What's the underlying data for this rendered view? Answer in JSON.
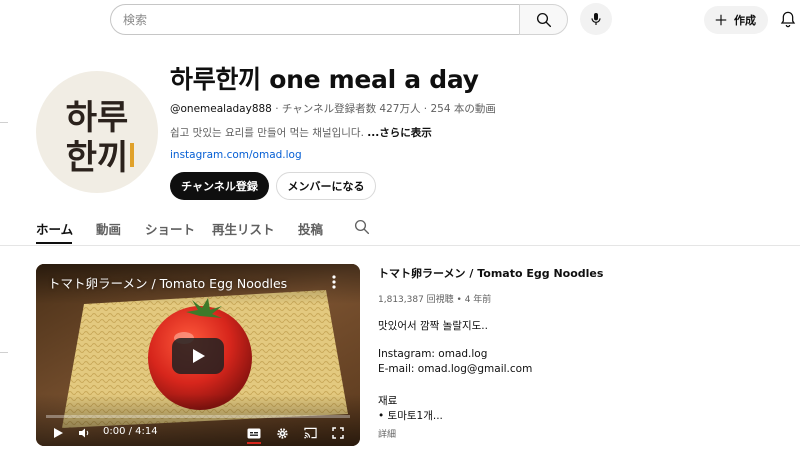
{
  "topbar": {
    "search_placeholder": "検索",
    "create_label": "作成"
  },
  "channel": {
    "avatar_text_line1": "하루",
    "avatar_text_line2": "한끼",
    "title": "하루한끼 one meal a day",
    "handle": "@onemealaday888",
    "stats": " · チャンネル登録者数 427万人 · 254 本の動画",
    "description": "쉽고 맛있는 요리를 만들어 먹는 채널입니다. ",
    "description_more": "...さらに表示",
    "link": "instagram.com/omad.log",
    "subscribe_label": "チャンネル登録",
    "member_label": "メンバーになる"
  },
  "tabs": [
    {
      "label": "ホーム",
      "active": true
    },
    {
      "label": "動画",
      "active": false
    },
    {
      "label": "ショート",
      "active": false
    },
    {
      "label": "再生リスト",
      "active": false
    },
    {
      "label": "投稿",
      "active": false
    }
  ],
  "player": {
    "overlay_title": "トマト卵ラーメン / Tomato Egg Noodles",
    "time": "0:00 / 4:14"
  },
  "video": {
    "title": "トマト卵ラーメン / Tomato Egg Noodles",
    "stats": "1,813,387 回視聴 • 4 年前",
    "description_lines": [
      "맛있어서 깜짝 놀랄지도..",
      "Instagram: omad.log",
      "E-mail: omad.log@gmail.com",
      "재료",
      "• 토마토1개..."
    ],
    "more_label": "詳細"
  },
  "colors": {
    "subscribe_bg": "#0f0f0f",
    "link": "#065fd4",
    "tomato": "#d7261c",
    "noodle": "#e8d188",
    "table": "#6b4524"
  }
}
